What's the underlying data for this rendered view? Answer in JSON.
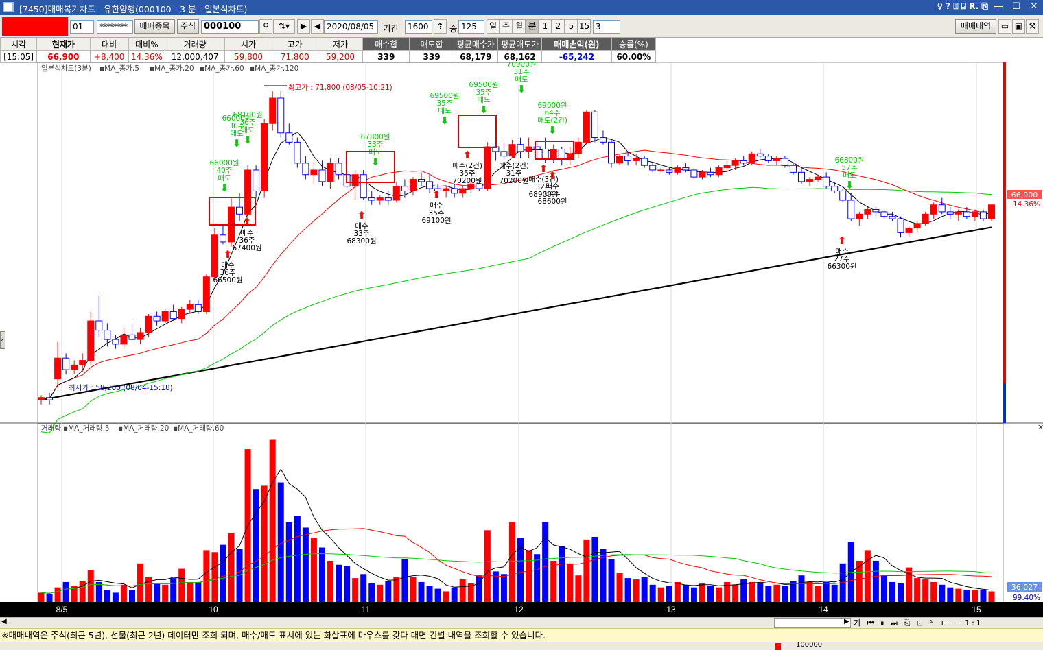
{
  "window": {
    "title": "[7450]매매복기차트 - 유한양행(000100 - 3 분 - 일본식차트)",
    "toolbar_glyphs": "♀ ? ⍐ ⍈ R. ⎘",
    "minimize": "—",
    "maximize": "☐",
    "close": "✕"
  },
  "toolbar": {
    "account_no": "01",
    "password": "********",
    "trade_items_btn": "매매종목",
    "market_type": "주식",
    "stock_code": "000100",
    "date": "2020/08/05",
    "period_label": "기간",
    "period_value": "1600",
    "overlap_label": "중",
    "overlap_value": "125",
    "periods": [
      "일",
      "주",
      "월",
      "분",
      "1",
      "2",
      "5",
      "15"
    ],
    "selected_period": "분",
    "minute_value": "3",
    "history_btn": "매매내역"
  },
  "info": {
    "headers": [
      "시각",
      "현재가",
      "대비",
      "대비%",
      "거래량",
      "시가",
      "고가",
      "저가",
      "매수합",
      "매도합",
      "평균매수가",
      "평균매도가",
      "매매손익(원)",
      "승률(%)"
    ],
    "values": [
      "[15:05]",
      "66,900",
      "+8,400",
      "14.36%",
      "12,000,407",
      "59,800",
      "71,800",
      "59,200",
      "339",
      "339",
      "68,179",
      "68,162",
      "-65,242",
      "60.00%"
    ]
  },
  "colors": {
    "up": "#ff0000",
    "down": "#0000ff",
    "ma5": "#000000",
    "ma20": "#ff0000",
    "ma60": "#00cc00",
    "ma120": "#000000",
    "buy_arrow": "#ff0000",
    "sell_arrow": "#00cc00"
  },
  "chart_data": {
    "type": "candlestick",
    "price_panel_label": "일본식차트(3분)",
    "price_legend": [
      {
        "name": "MA_종가,5",
        "color": "#ff0000"
      },
      {
        "name": "MA_종가,20",
        "color": "#000000"
      },
      {
        "name": "MA_종가,60",
        "color": "#ff0000"
      },
      {
        "name": "MA_종가,120",
        "color": "#00cc00"
      }
    ],
    "volume_panel_label": "거래량",
    "volume_legend": [
      {
        "name": "MA_거래량,5",
        "color": "#ff0000"
      },
      {
        "name": "MA_거래량,20",
        "color": "#000000"
      },
      {
        "name": "MA_거래량,60",
        "color": "#ff0000"
      }
    ],
    "x_axis": {
      "labels": [
        "8/5",
        "10",
        "11",
        "12",
        "13",
        "14",
        "15"
      ]
    },
    "high_note": "최고가 : 71,800 (08/05-10:21)",
    "low_note": "최저가 : 58,200 (08/04-15:18)",
    "current_price_tag": "66,900",
    "current_pct_tag": "14.36%",
    "volume_tag": "36,027",
    "volume_pct_tag": "99.40%",
    "price_range": [
      57500,
      72800
    ],
    "volume_range": [
      0,
      260000
    ],
    "candles": [
      [
        58500,
        58700,
        58300,
        58600,
        14000
      ],
      [
        58600,
        58800,
        58300,
        58500,
        12000
      ],
      [
        59400,
        61000,
        59000,
        60300,
        22000
      ],
      [
        60300,
        60500,
        59600,
        59800,
        30000
      ],
      [
        59800,
        60200,
        59600,
        60000,
        24000
      ],
      [
        60000,
        60500,
        59700,
        60200,
        32000
      ],
      [
        60200,
        62300,
        60000,
        61900,
        48000
      ],
      [
        61900,
        63000,
        61200,
        61500,
        30000
      ],
      [
        61500,
        61800,
        60800,
        61100,
        18000
      ],
      [
        61100,
        61300,
        60700,
        60900,
        14000
      ],
      [
        60900,
        61600,
        60700,
        61300,
        26000
      ],
      [
        61300,
        61800,
        61000,
        61100,
        18000
      ],
      [
        61100,
        61600,
        60900,
        61400,
        58000
      ],
      [
        61400,
        62200,
        61200,
        62100,
        38000
      ],
      [
        62100,
        62300,
        61700,
        61900,
        28000
      ],
      [
        61900,
        62400,
        61800,
        62300,
        26000
      ],
      [
        62300,
        62600,
        61900,
        62000,
        36000
      ],
      [
        62000,
        62500,
        61800,
        62400,
        50000
      ],
      [
        62400,
        62800,
        62200,
        62600,
        30000
      ],
      [
        62600,
        62800,
        62200,
        62300,
        30000
      ],
      [
        62300,
        63900,
        62200,
        63800,
        78000
      ],
      [
        63800,
        65900,
        63700,
        65600,
        75000
      ],
      [
        65600,
        66000,
        65200,
        65300,
        86000
      ],
      [
        65300,
        67200,
        65100,
        66800,
        104000
      ],
      [
        66800,
        67400,
        66200,
        66500,
        80000
      ],
      [
        66500,
        68600,
        66100,
        68400,
        230000
      ],
      [
        68400,
        68600,
        67200,
        67500,
        170000
      ],
      [
        67500,
        70600,
        67200,
        70400,
        175000
      ],
      [
        70400,
        71800,
        70100,
        71500,
        245000
      ],
      [
        71500,
        71800,
        69800,
        70000,
        180000
      ],
      [
        70000,
        70400,
        69500,
        69600,
        120000
      ],
      [
        69600,
        69800,
        68500,
        68700,
        130000
      ],
      [
        68700,
        69000,
        68000,
        68200,
        112000
      ],
      [
        68200,
        68700,
        67800,
        68400,
        96000
      ],
      [
        68400,
        68800,
        67700,
        67900,
        82000
      ],
      [
        67900,
        68900,
        67600,
        68700,
        62000
      ],
      [
        68700,
        68900,
        68000,
        68200,
        56000
      ],
      [
        68200,
        68400,
        67600,
        67700,
        54000
      ],
      [
        67700,
        68400,
        67100,
        68200,
        36000
      ],
      [
        68200,
        68400,
        67100,
        67200,
        42000
      ],
      [
        67200,
        67500,
        66900,
        67100,
        28000
      ],
      [
        67100,
        67300,
        66900,
        67200,
        26000
      ],
      [
        67200,
        67500,
        66900,
        67100,
        32000
      ],
      [
        67100,
        67900,
        67000,
        67700,
        38000
      ],
      [
        67700,
        68000,
        67200,
        67500,
        64000
      ],
      [
        67500,
        68100,
        67300,
        68000,
        38000
      ],
      [
        68000,
        68300,
        67700,
        67900,
        30000
      ],
      [
        67900,
        68200,
        67400,
        67600,
        24000
      ],
      [
        67600,
        67800,
        67200,
        67500,
        20000
      ],
      [
        67500,
        67700,
        67200,
        67600,
        16000
      ],
      [
        67600,
        67800,
        67200,
        67400,
        22000
      ],
      [
        67400,
        67700,
        67200,
        67600,
        34000
      ],
      [
        67600,
        67900,
        67400,
        67800,
        28000
      ],
      [
        67800,
        68000,
        67500,
        67600,
        40000
      ],
      [
        67600,
        69600,
        67500,
        69400,
        108000
      ],
      [
        69400,
        69900,
        68800,
        69200,
        46000
      ],
      [
        69200,
        69600,
        68800,
        69000,
        42000
      ],
      [
        69000,
        69700,
        68900,
        69500,
        120000
      ],
      [
        69500,
        69800,
        68900,
        69200,
        96000
      ],
      [
        69200,
        69800,
        68900,
        69400,
        78000
      ],
      [
        69400,
        69700,
        68900,
        69300,
        72000
      ],
      [
        69300,
        69800,
        68700,
        68900,
        120000
      ],
      [
        68900,
        69500,
        68700,
        69300,
        62000
      ],
      [
        69300,
        69400,
        68600,
        68900,
        84000
      ],
      [
        68900,
        69400,
        68600,
        69100,
        58000
      ],
      [
        69100,
        69800,
        68900,
        69600,
        40000
      ],
      [
        69600,
        71000,
        69500,
        70900,
        94000
      ],
      [
        70900,
        71000,
        69600,
        69800,
        98000
      ],
      [
        69800,
        70100,
        69500,
        69600,
        80000
      ],
      [
        69600,
        69700,
        68500,
        68700,
        64000
      ],
      [
        68700,
        69100,
        68600,
        69000,
        44000
      ],
      [
        69000,
        69200,
        68600,
        68800,
        36000
      ],
      [
        68800,
        69100,
        68600,
        68900,
        34000
      ],
      [
        68900,
        69000,
        68500,
        68600,
        38000
      ],
      [
        68600,
        68700,
        68300,
        68400,
        26000
      ],
      [
        68400,
        68500,
        68300,
        68400,
        22000
      ],
      [
        68400,
        68500,
        68200,
        68300,
        24000
      ],
      [
        68300,
        68600,
        68200,
        68500,
        30000
      ],
      [
        68500,
        68700,
        68300,
        68400,
        26000
      ],
      [
        68400,
        68500,
        68000,
        68100,
        22000
      ],
      [
        68100,
        68400,
        68000,
        68300,
        28000
      ],
      [
        68300,
        68500,
        68100,
        68200,
        24000
      ],
      [
        68200,
        68600,
        68100,
        68500,
        22000
      ],
      [
        68500,
        68800,
        68300,
        68600,
        30000
      ],
      [
        68600,
        68900,
        68400,
        68800,
        26000
      ],
      [
        68800,
        69000,
        68600,
        68700,
        34000
      ],
      [
        68700,
        69200,
        68600,
        69100,
        30000
      ],
      [
        69100,
        69300,
        68900,
        69000,
        28000
      ],
      [
        69000,
        69100,
        68700,
        68800,
        24000
      ],
      [
        68800,
        69000,
        68600,
        68900,
        26000
      ],
      [
        68900,
        69000,
        68500,
        68600,
        24000
      ],
      [
        68600,
        68700,
        68200,
        68300,
        32000
      ],
      [
        68300,
        68500,
        67800,
        67900,
        40000
      ],
      [
        67900,
        68100,
        67700,
        68000,
        30000
      ],
      [
        68000,
        68200,
        67900,
        68100,
        24000
      ],
      [
        68100,
        68300,
        67600,
        67700,
        30000
      ],
      [
        67700,
        67900,
        67400,
        67500,
        26000
      ],
      [
        67500,
        67600,
        67000,
        67100,
        58000
      ],
      [
        67100,
        67400,
        66200,
        66300,
        90000
      ],
      [
        66300,
        66600,
        66000,
        66500,
        62000
      ],
      [
        66500,
        66800,
        66300,
        66700,
        78000
      ],
      [
        66700,
        66800,
        66400,
        66600,
        62000
      ],
      [
        66600,
        66700,
        66300,
        66400,
        40000
      ],
      [
        66400,
        66600,
        66200,
        66300,
        30000
      ],
      [
        66300,
        66400,
        65500,
        65700,
        28000
      ],
      [
        65700,
        66000,
        65500,
        65900,
        52000
      ],
      [
        65900,
        66200,
        65700,
        66100,
        36000
      ],
      [
        66100,
        66600,
        66000,
        66500,
        34000
      ],
      [
        66500,
        67000,
        66300,
        66900,
        30000
      ],
      [
        66900,
        67200,
        66500,
        66600,
        26000
      ],
      [
        66600,
        66800,
        66300,
        66500,
        22000
      ],
      [
        66500,
        66700,
        66200,
        66600,
        20000
      ],
      [
        66600,
        66800,
        66300,
        66400,
        18000
      ],
      [
        66400,
        66700,
        66200,
        66600,
        18000
      ],
      [
        66600,
        66700,
        66200,
        66300,
        18000
      ],
      [
        66300,
        66900,
        66200,
        66900,
        16000
      ]
    ],
    "annotations": [
      {
        "text": "66000원",
        "sub": "40주",
        "action": "매도"
      },
      {
        "text": "66000원",
        "sub": "36주",
        "action": "매도"
      },
      {
        "text": "68100원",
        "sub": "36주",
        "action": "매도"
      },
      {
        "text": "67800원",
        "sub": "33주",
        "action": "매도"
      },
      {
        "text": "69500원",
        "sub": "35주",
        "action": "매도"
      },
      {
        "text": "69500원",
        "sub": "35주",
        "action": "매도"
      },
      {
        "text": "70900원",
        "sub": "31주",
        "action": "매도"
      },
      {
        "text": "69000원",
        "sub": "64주",
        "action": "매도(2건)"
      },
      {
        "text": "66800원",
        "sub": "57주",
        "action": "매도"
      },
      {
        "text": "66500원",
        "sub": "36주",
        "action": "매수"
      },
      {
        "text": "67400원",
        "sub": "36주",
        "action": "매수"
      },
      {
        "text": "68300원",
        "sub": "33주",
        "action": "매수"
      },
      {
        "text": "69100원",
        "sub": "35주",
        "action": "매수"
      },
      {
        "text": "70200원",
        "sub": "35주",
        "action": "매수(2건)"
      },
      {
        "text": "70200원",
        "sub": "31주",
        "action": "매수(2건)"
      },
      {
        "text": "68900원",
        "sub": "32주",
        "action": "매수(3건)"
      },
      {
        "text": "68600원",
        "sub": "64주",
        "action": "매수"
      },
      {
        "text": "66300원",
        "sub": "27주",
        "action": "매수"
      }
    ]
  },
  "status_text": "※매매내역은 주식(최근 5년), 선물(최근 2년) 데이터만 조회 되며, 매수/매도 표시에 있는 화살표에 마우스를 갖다 대면 건별 내역을 조회할 수 있습니다.",
  "bottom_value": "100000",
  "scroll_controls": "기 ⏮ ⏸ ⏭ ⎗ ⊡ ᴬ + − 1:1"
}
